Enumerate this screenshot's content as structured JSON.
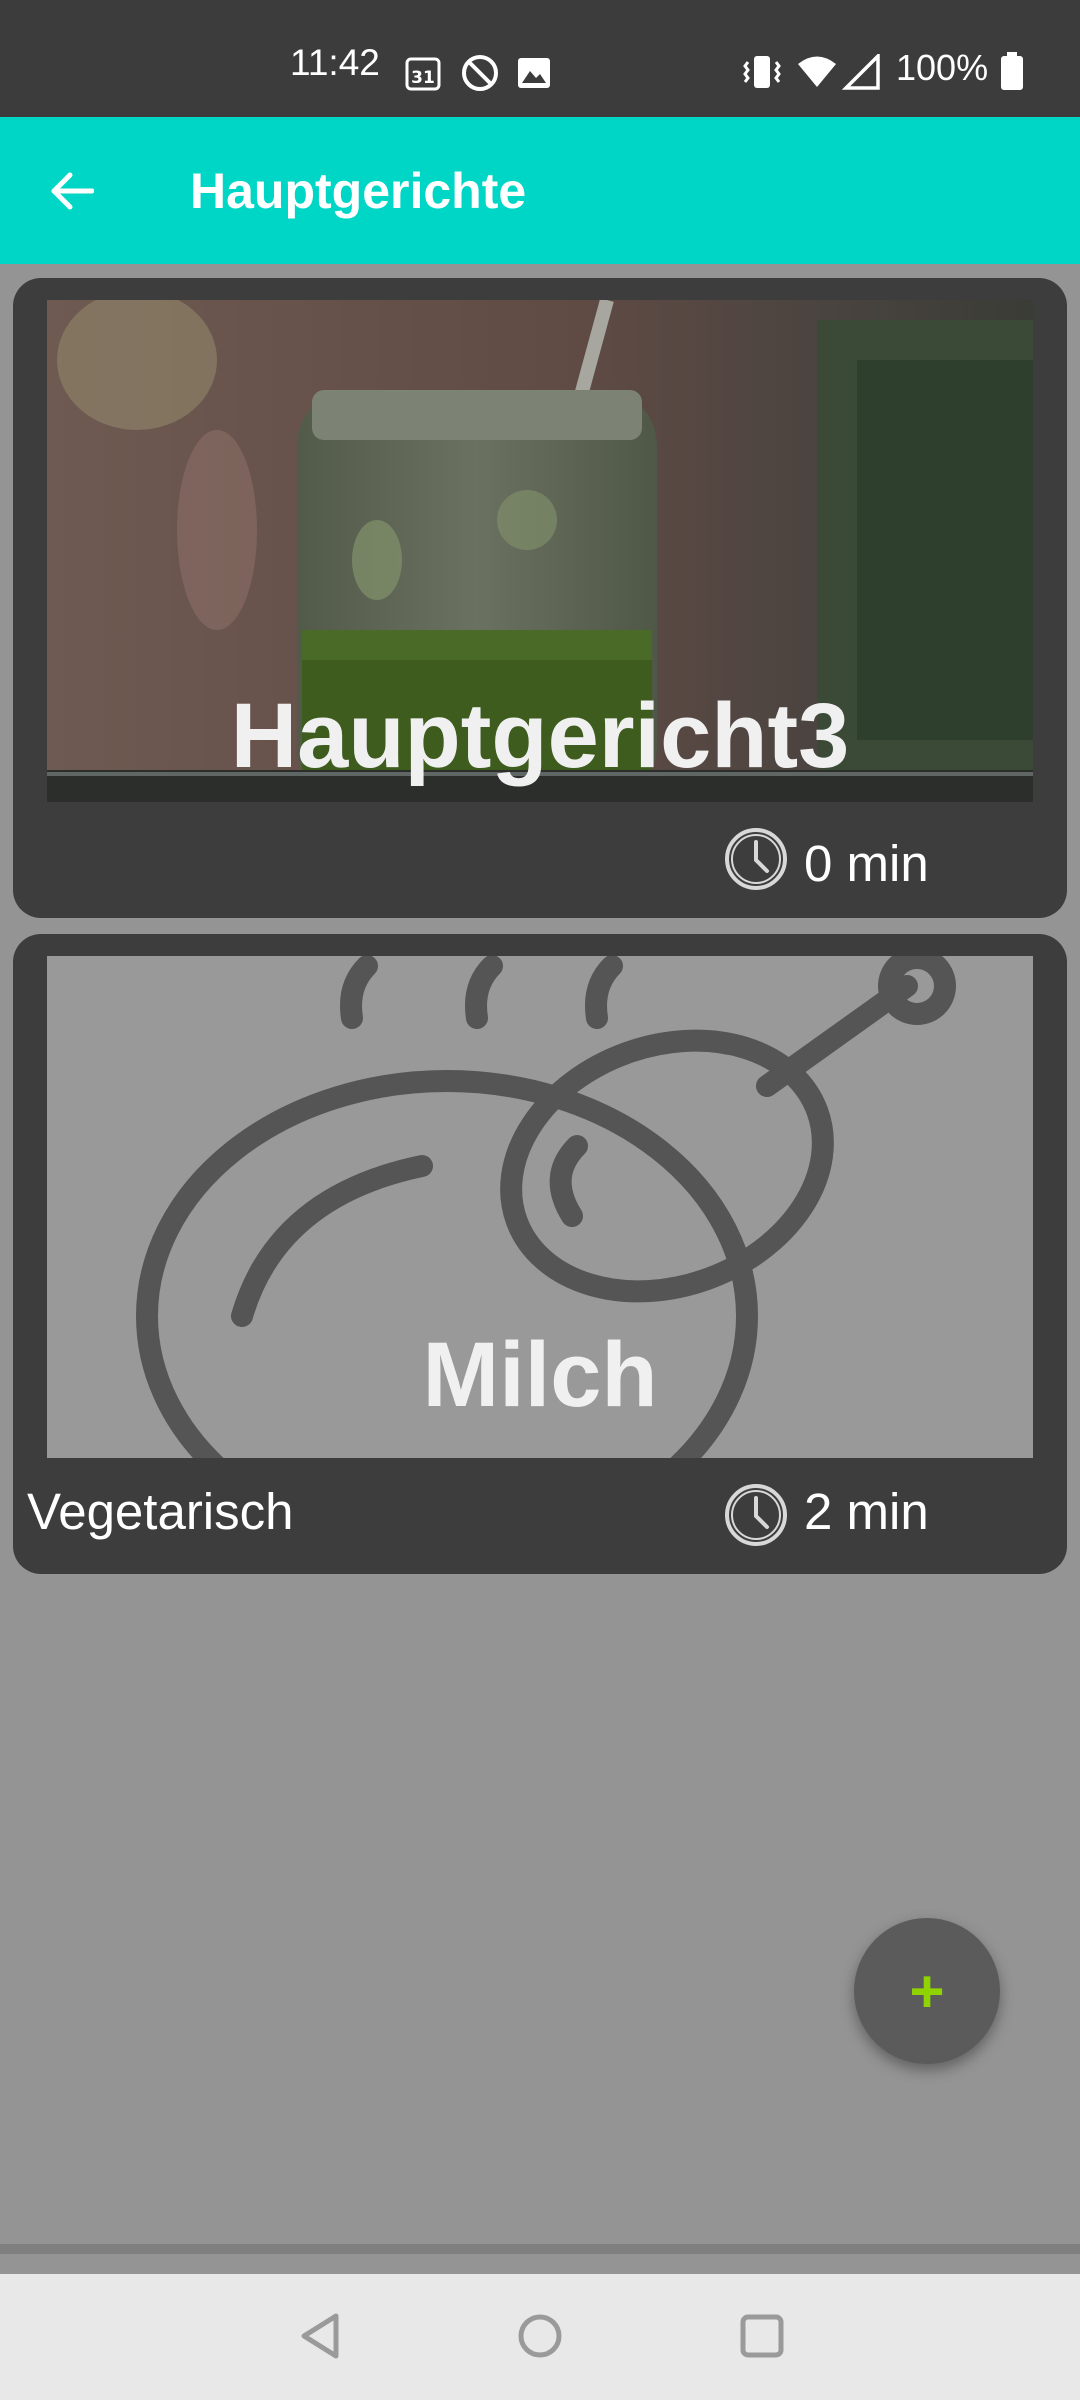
{
  "status_bar": {
    "time": "11:42",
    "battery": "100%",
    "icons": [
      "calendar-icon",
      "do-not-disturb-icon",
      "image-icon",
      "vibrate-icon",
      "wifi-icon",
      "signal-icon",
      "battery-icon"
    ],
    "calendar_day": "31"
  },
  "app_bar": {
    "title": "Hauptgerichte",
    "background_color": "#00d6c6",
    "back_icon": "arrow-back-icon"
  },
  "recipes": [
    {
      "title": "Hauptgericht3",
      "category": "",
      "time": "0 min",
      "image": "green-smoothie-jar-photo"
    },
    {
      "title": "Milch",
      "category": "Vegetarisch",
      "time": "2 min",
      "image": "frying-pan-placeholder-icon"
    }
  ],
  "fab": {
    "label": "+",
    "icon": "add-icon",
    "color": "#8fd400"
  },
  "nav_bar": {
    "icons": [
      "back-triangle-icon",
      "home-circle-icon",
      "recents-square-icon"
    ]
  }
}
